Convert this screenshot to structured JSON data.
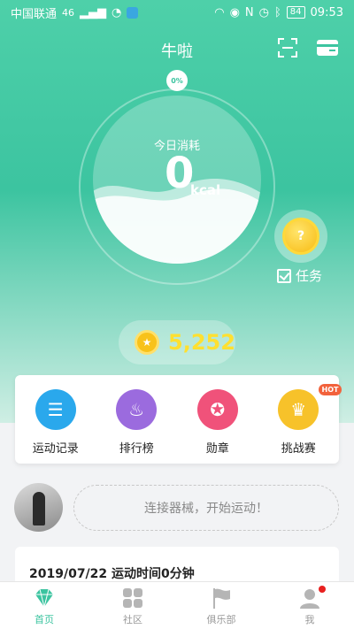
{
  "status_bar": {
    "carrier": "中国联通",
    "signal": "46",
    "battery": "84",
    "time": "09:53"
  },
  "header": {
    "title": "牛啦"
  },
  "gauge": {
    "percent_badge": "0%",
    "label": "今日消耗",
    "value": "0",
    "unit": "kcal"
  },
  "task": {
    "coin_symbol": "?",
    "label": "任务"
  },
  "coins": {
    "amount": "5,252"
  },
  "features": [
    {
      "label": "运动记录",
      "icon": "list-icon",
      "color": "#2aa8ec"
    },
    {
      "label": "排行榜",
      "icon": "flame-icon",
      "color": "#9b6bde"
    },
    {
      "label": "勋章",
      "icon": "medal-icon",
      "color": "#f0527a"
    },
    {
      "label": "挑战赛",
      "icon": "crown-icon",
      "color": "#f7c22a",
      "badge": "HOT"
    }
  ],
  "connect": {
    "text": "连接器械，开始运动！"
  },
  "record": {
    "title": "2019/07/22 运动时间0分钟"
  },
  "bottom_nav": [
    {
      "label": "首页",
      "icon": "diamond-icon",
      "active": true
    },
    {
      "label": "社区",
      "icon": "grid-icon",
      "active": false
    },
    {
      "label": "俱乐部",
      "icon": "flag-icon",
      "active": false
    },
    {
      "label": "我",
      "icon": "user-icon",
      "active": false
    }
  ],
  "colors": {
    "accent": "#3cc4a0",
    "coin": "#ffe030",
    "notification": "#e8201f"
  }
}
